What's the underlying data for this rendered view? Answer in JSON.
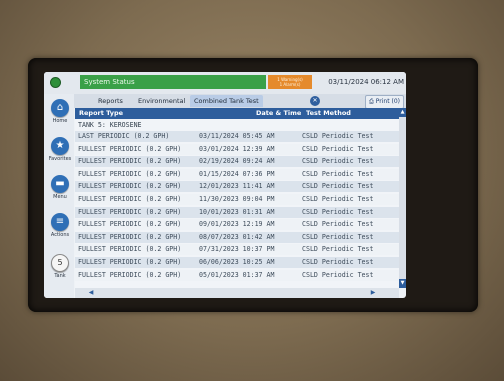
{
  "header": {
    "status_title": "System Status",
    "status_warning": "1 Warning(s)\n1 Alarm(s)",
    "datetime": "03/11/2024 06:12 AM"
  },
  "tabs": [
    {
      "label": "Reports"
    },
    {
      "label": "Environmental"
    },
    {
      "label": "Combined Tank Test"
    }
  ],
  "print_label": "Print (0)",
  "sidebar": [
    {
      "label": "Home",
      "icon": "home-icon",
      "glyph": "⌂"
    },
    {
      "label": "Favorites",
      "icon": "star-icon",
      "glyph": "★"
    },
    {
      "label": "Menu",
      "icon": "menu-icon",
      "glyph": "▬"
    },
    {
      "label": "Actions",
      "icon": "list-icon",
      "glyph": "≡"
    },
    {
      "label": "Tank",
      "icon": "tank-icon",
      "glyph": "5"
    }
  ],
  "table": {
    "headers": {
      "type": "Report Type",
      "datetime": "Date & Time",
      "method": "Test Method"
    },
    "section": "TANK 5: KEROSENE",
    "rows": [
      {
        "type": "LAST PERIODIC (0.2 GPH)",
        "datetime": "03/11/2024 05:45 AM",
        "method": "CSLD Periodic Test"
      },
      {
        "type": "FULLEST PERIODIC (0.2 GPH)",
        "datetime": "03/01/2024 12:39 AM",
        "method": "CSLD Periodic Test"
      },
      {
        "type": "FULLEST PERIODIC (0.2 GPH)",
        "datetime": "02/19/2024 09:24 AM",
        "method": "CSLD Periodic Test"
      },
      {
        "type": "FULLEST PERIODIC (0.2 GPH)",
        "datetime": "01/15/2024 07:36 PM",
        "method": "CSLD Periodic Test"
      },
      {
        "type": "FULLEST PERIODIC (0.2 GPH)",
        "datetime": "12/01/2023 11:41 AM",
        "method": "CSLD Periodic Test"
      },
      {
        "type": "FULLEST PERIODIC (0.2 GPH)",
        "datetime": "11/30/2023 09:04 PM",
        "method": "CSLD Periodic Test"
      },
      {
        "type": "FULLEST PERIODIC (0.2 GPH)",
        "datetime": "10/01/2023 01:31 AM",
        "method": "CSLD Periodic Test"
      },
      {
        "type": "FULLEST PERIODIC (0.2 GPH)",
        "datetime": "09/01/2023 12:19 AM",
        "method": "CSLD Periodic Test"
      },
      {
        "type": "FULLEST PERIODIC (0.2 GPH)",
        "datetime": "08/07/2023 01:42 AM",
        "method": "CSLD Periodic Test"
      },
      {
        "type": "FULLEST PERIODIC (0.2 GPH)",
        "datetime": "07/31/2023 10:37 PM",
        "method": "CSLD Periodic Test"
      },
      {
        "type": "FULLEST PERIODIC (0.2 GPH)",
        "datetime": "06/06/2023 10:25 AM",
        "method": "CSLD Periodic Test"
      },
      {
        "type": "FULLEST PERIODIC (0.2 GPH)",
        "datetime": "05/01/2023 01:37 AM",
        "method": "CSLD Periodic Test"
      }
    ]
  }
}
